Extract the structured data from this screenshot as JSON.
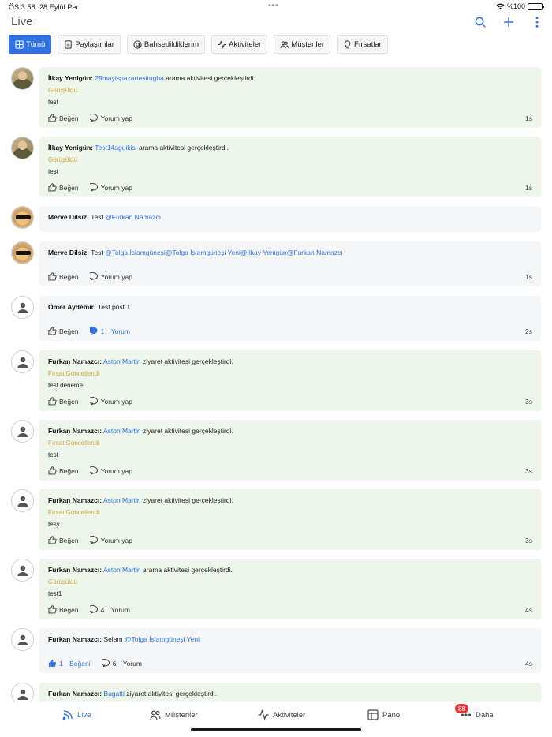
{
  "status_bar": {
    "time": "ÖS 3:58",
    "date": "28 Eylül Per",
    "battery": "%100"
  },
  "header": {
    "title": "Live"
  },
  "tabs": [
    {
      "label": "Tümü",
      "icon": "grid-icon",
      "active": true
    },
    {
      "label": "Paylaşımlar",
      "icon": "document-icon",
      "active": false
    },
    {
      "label": "Bahsedildiklerim",
      "icon": "at-sign-icon",
      "active": false
    },
    {
      "label": "Aktiviteler",
      "icon": "activity-icon",
      "active": false
    },
    {
      "label": "Müşteriler",
      "icon": "users-icon",
      "active": false
    },
    {
      "label": "Fırsatlar",
      "icon": "lightbulb-icon",
      "active": false
    }
  ],
  "labels": {
    "like": "Beğen",
    "comment": "Yorum yap",
    "comment_count_word": "Yorum",
    "like_count_word": "Beğeni"
  },
  "posts": [
    {
      "author": "İlkay Yenigün:",
      "link": "29mayispazartesitugba",
      "text": "arama aktivitesi gerçekleştirdi.",
      "status": "Görüşüldü",
      "note": "test",
      "time": "1s"
    },
    {
      "author": "İlkay Yenigün:",
      "link": "Test14aguikisi",
      "text": "arama aktivitesi gerçekleştirdi.",
      "status": "Görüşüldü",
      "note": "test",
      "time": "1s"
    },
    {
      "author": "Merve Dilsiz:",
      "text": "Test",
      "link": "@Furkan Namazcı"
    },
    {
      "author": "Merve Dilsiz:",
      "text": "Test",
      "link": "@Tolga İslamgüneşi@Tolga İslamgüneşi Yeni@İlkay Yenigün@Furkan Namazcı",
      "time": "1s"
    },
    {
      "author": "Ömer Aydemir:",
      "text": "Test post 1",
      "comment_count": "1",
      "time": "2s"
    },
    {
      "author": "Furkan Namazcı:",
      "link": "Aston Martin",
      "text": "ziyaret aktivitesi gerçekleştirdi.",
      "status": "Fırsat Güncellendi",
      "note": "test deneme.",
      "time": "3s"
    },
    {
      "author": "Furkan Namazcı:",
      "link": "Aston Martin",
      "text": "ziyaret aktivitesi gerçekleştirdi.",
      "status": "Fırsat Güncellendi",
      "note": "test",
      "time": "3s"
    },
    {
      "author": "Furkan Namazcı:",
      "link": "Aston Martin",
      "text": "ziyaret aktivitesi gerçekleştirdi.",
      "status": "Fırsat Güncellendi",
      "note": "tesy",
      "time": "3s"
    },
    {
      "author": "Furkan Namazcı:",
      "link": "Aston Martin",
      "text": "arama aktivitesi gerçekleştirdi.",
      "status": "Görüşüldü",
      "note": "test1",
      "comment_count": "4",
      "time": "4s"
    },
    {
      "author": "Furkan Namazcı:",
      "text": "Selam",
      "link": "@Tolga İslamgüneşi Yeni",
      "like_count": "1",
      "comment_count": "6",
      "time": "4s"
    },
    {
      "author": "Furkan Namazcı:",
      "link": "Bugatti",
      "text": "ziyaret aktivitesi gerçekleştirdi."
    }
  ],
  "bottom_nav": [
    {
      "label": "Live",
      "icon": "rss-icon",
      "active": true
    },
    {
      "label": "Müşteriler",
      "icon": "users-icon",
      "active": false
    },
    {
      "label": "Aktiviteler",
      "icon": "activity-icon",
      "active": false
    },
    {
      "label": "Pano",
      "icon": "layout-icon",
      "active": false
    },
    {
      "label": "Daha",
      "icon": "more-icon",
      "active": false,
      "badge": "88"
    }
  ],
  "colors": {
    "accent": "#2f72e0",
    "activity_card": "#eef6ec",
    "post_card": "#f5f6f8",
    "status_label": "#d3a43a",
    "badge": "#e23b3b"
  }
}
